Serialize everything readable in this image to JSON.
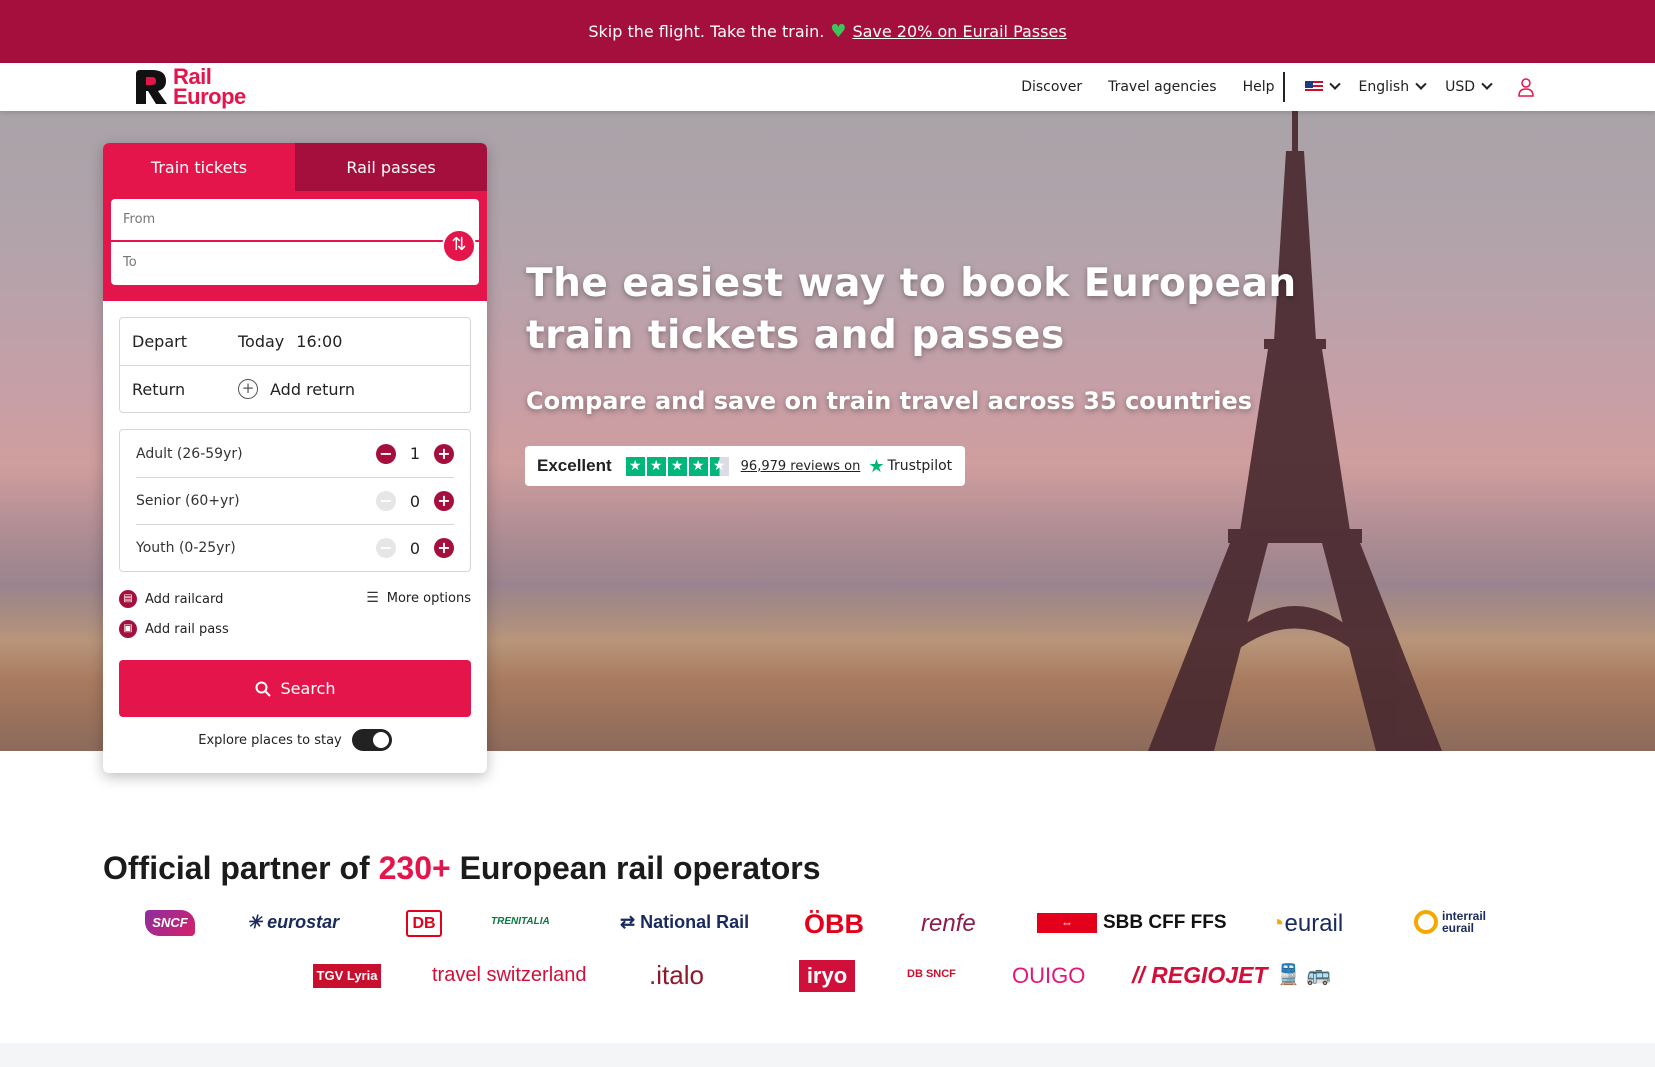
{
  "promo": {
    "text": "Skip the flight. Take the train.",
    "link": "Save 20% on Eurail Passes"
  },
  "header": {
    "logo_line1": "Rail",
    "logo_line2": "Europe",
    "nav": [
      "Discover",
      "Travel agencies",
      "Help"
    ],
    "language": "English",
    "currency": "USD"
  },
  "hero": {
    "heading": "The easiest way to book European train tickets and passes",
    "subheading": "Compare and save on train travel across 35 countries",
    "trustpilot": {
      "rating_label": "Excellent",
      "stars": 4.5,
      "reviews": "96,979 reviews on",
      "brand": "Trustpilot"
    }
  },
  "widget": {
    "tabs": [
      "Train tickets",
      "Rail passes"
    ],
    "from_placeholder": "From",
    "to_placeholder": "To",
    "depart_label": "Depart",
    "depart_day": "Today",
    "depart_time": "16:00",
    "return_label": "Return",
    "return_action": "Add return",
    "passengers": [
      {
        "label": "Adult (26-59yr)",
        "count": "1"
      },
      {
        "label": "Senior (60+yr)",
        "count": "0"
      },
      {
        "label": "Youth (0-25yr)",
        "count": "0"
      }
    ],
    "add_railcard": "Add railcard",
    "more_options": "More options",
    "add_rail_pass": "Add rail pass",
    "search_label": "Search",
    "explore_label": "Explore places to stay"
  },
  "partners": {
    "title_prefix": "Official partner of",
    "title_count": "230+",
    "title_suffix": "European rail operators",
    "row1": [
      "SNCF",
      "eurostar",
      "DB",
      "TRENITALIA",
      "National Rail",
      "ÖBB",
      "renfe",
      "SBB CFF FFS",
      "eurail",
      "interrail eurail"
    ],
    "row2": [
      "TGV Lyria",
      "travel switzerland",
      "italo",
      "iryo",
      "DB SNCF",
      "OUIGO",
      "REGIOJET"
    ]
  },
  "colors": {
    "brand": "#e4154b",
    "brand_dark": "#a50f3d",
    "trustpilot_green": "#00b67a"
  }
}
